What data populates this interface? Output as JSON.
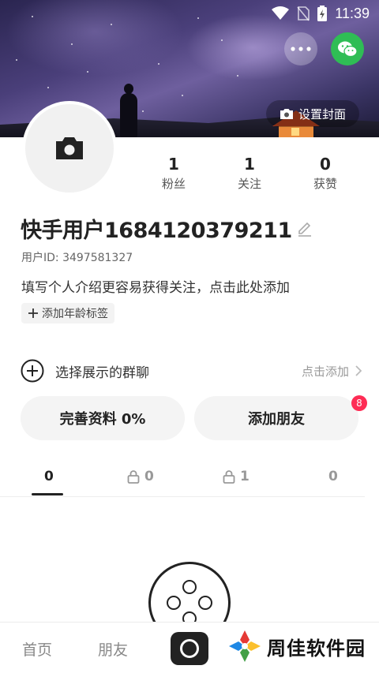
{
  "status_bar": {
    "time": "11:39"
  },
  "header": {
    "cover_button_label": "设置封面"
  },
  "profile": {
    "username": "快手用户1684120379211",
    "user_id": "用户ID: 3497581327",
    "bio": "填写个人介绍更容易获得关注，点击此处添加",
    "tag_button_label": "添加年龄标签"
  },
  "stats": [
    {
      "value": "1",
      "label": "粉丝"
    },
    {
      "value": "1",
      "label": "关注"
    },
    {
      "value": "0",
      "label": "获赞"
    }
  ],
  "group_chat": {
    "label": "选择展示的群聊",
    "action": "点击添加"
  },
  "buttons": {
    "complete_profile": "完善资料 0%",
    "add_friends": "添加朋友",
    "add_friends_badge": "8"
  },
  "tabs": [
    {
      "count": "0",
      "locked": false
    },
    {
      "count": "0",
      "locked": true
    },
    {
      "count": "1",
      "locked": true
    },
    {
      "count": "0",
      "locked": false
    }
  ],
  "bottom_nav": {
    "home": "首页",
    "friends": "朋友"
  },
  "watermark": {
    "brand": "周佳软件园"
  },
  "colors": {
    "accent_badge": "#fe2c55",
    "wechat": "#2fbd55"
  }
}
